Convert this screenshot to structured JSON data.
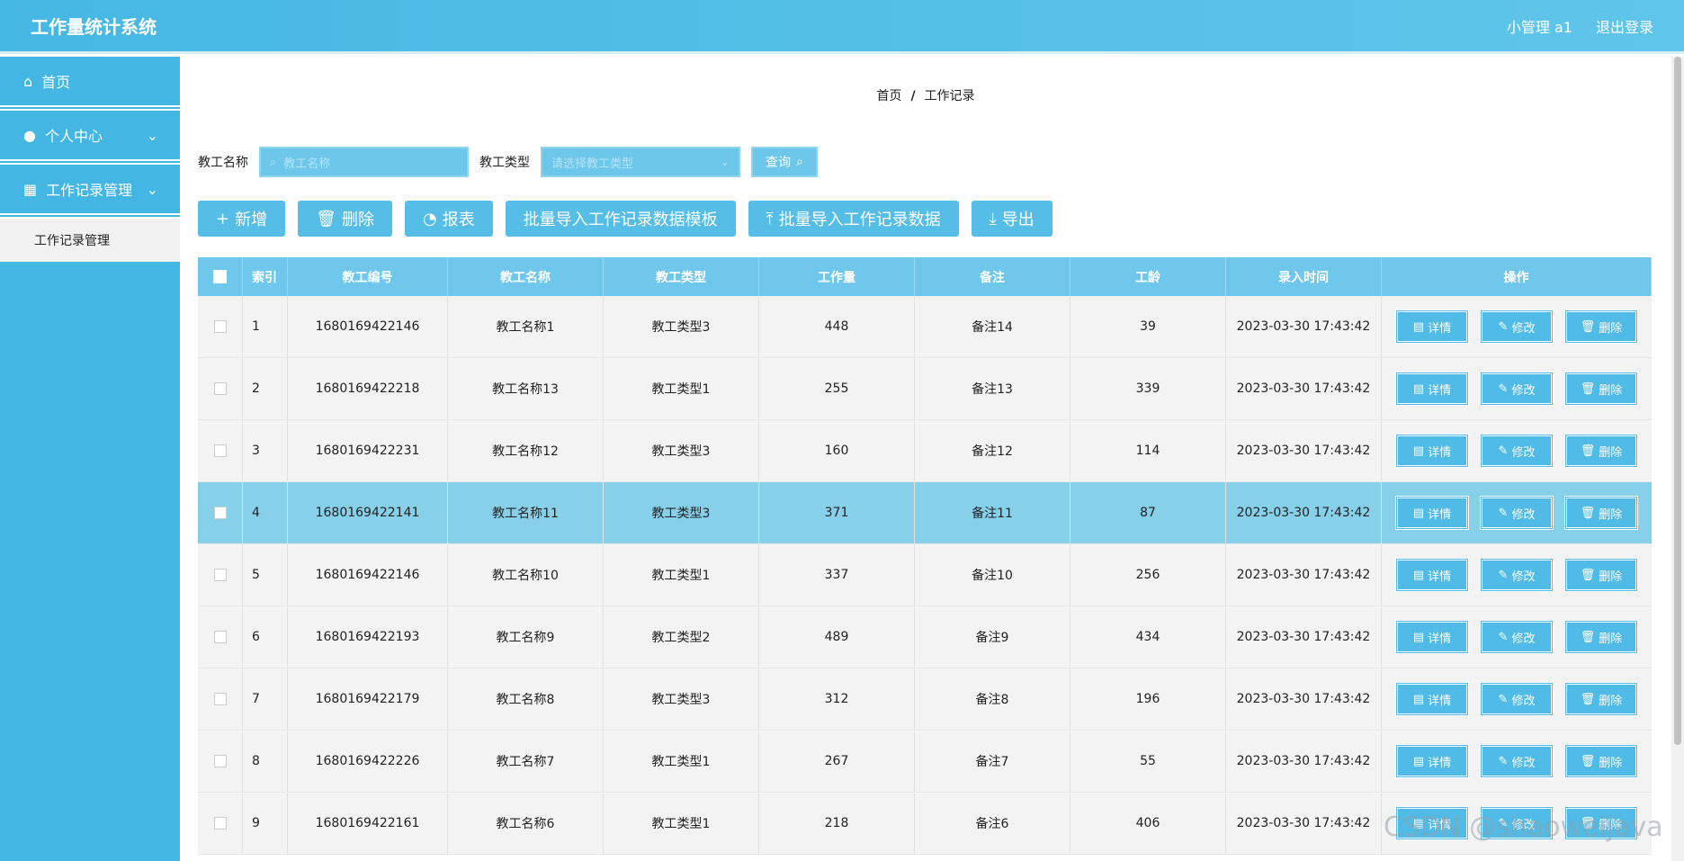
{
  "header": {
    "title": "工作量统计系统",
    "user": "小管理 a1",
    "logout": "退出登录"
  },
  "sidebar": {
    "items": [
      {
        "label": "首页",
        "icon": "home-icon"
      },
      {
        "label": "个人中心",
        "icon": "user-icon"
      },
      {
        "label": "工作记录管理",
        "icon": "grid-icon"
      }
    ],
    "subitem": "工作记录管理"
  },
  "breadcrumb": {
    "home": "首页",
    "sep": "/",
    "current": "工作记录"
  },
  "search": {
    "name_label": "教工名称",
    "name_placeholder": "教工名称",
    "type_label": "教工类型",
    "type_placeholder": "请选择教工类型",
    "query_label": "查询"
  },
  "toolbar": {
    "add": "新增",
    "delete": "删除",
    "report": "报表",
    "import_template": "批量导入工作记录数据模板",
    "import_data": "批量导入工作记录数据",
    "export": "导出"
  },
  "table": {
    "headers": [
      "索引",
      "教工编号",
      "教工名称",
      "教工类型",
      "工作量",
      "备注",
      "工龄",
      "录入时间",
      "操作"
    ],
    "actions": {
      "detail": "详情",
      "edit": "修改",
      "delete": "删除"
    },
    "rows": [
      [
        "1",
        "1680169422146",
        "教工名称1",
        "教工类型3",
        "448",
        "备注14",
        "39",
        "2023-03-30 17:43:42"
      ],
      [
        "2",
        "1680169422218",
        "教工名称13",
        "教工类型1",
        "255",
        "备注13",
        "339",
        "2023-03-30 17:43:42"
      ],
      [
        "3",
        "1680169422231",
        "教工名称12",
        "教工类型3",
        "160",
        "备注12",
        "114",
        "2023-03-30 17:43:42"
      ],
      [
        "4",
        "1680169422141",
        "教工名称11",
        "教工类型3",
        "371",
        "备注11",
        "87",
        "2023-03-30 17:43:42"
      ],
      [
        "5",
        "1680169422146",
        "教工名称10",
        "教工类型1",
        "337",
        "备注10",
        "256",
        "2023-03-30 17:43:42"
      ],
      [
        "6",
        "1680169422193",
        "教工名称9",
        "教工类型2",
        "489",
        "备注9",
        "434",
        "2023-03-30 17:43:42"
      ],
      [
        "7",
        "1680169422179",
        "教工名称8",
        "教工类型3",
        "312",
        "备注8",
        "196",
        "2023-03-30 17:43:42"
      ],
      [
        "8",
        "1680169422226",
        "教工名称7",
        "教工类型1",
        "267",
        "备注7",
        "55",
        "2023-03-30 17:43:42"
      ],
      [
        "9",
        "1680169422161",
        "教工名称6",
        "教工类型1",
        "218",
        "备注6",
        "406",
        "2023-03-30 17:43:42"
      ]
    ]
  },
  "watermark": "CSDN @shaoweijava"
}
